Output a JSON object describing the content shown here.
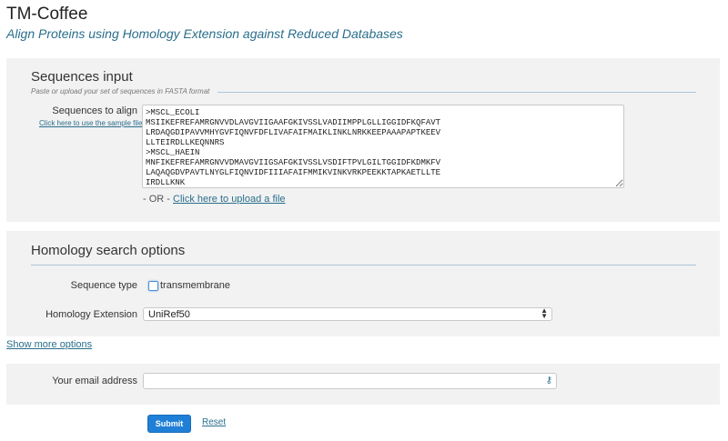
{
  "header": {
    "title": "TM-Coffee",
    "subtitle": "Align Proteins using Homology Extension against Reduced Databases"
  },
  "sequences_section": {
    "legend": "Sequences input",
    "help": "Paste or upload your set of sequences in FASTA format",
    "label": "Sequences to align",
    "sample_link": "Click here to use the sample file",
    "value": ">MSCL_ECOLI\nMSIIKEFREFAMRGNVVDLAVGVIIGAAFGKIVSSLVADIIMPPLGLLIGGIDFKQFAVT\nLRDAQGDIPAVVMHYGVFIQNVFDFLIVAFAIFMAIKLINKLNRKKEEPAAAPAPTKEEV\nLLTEIRDLLKEQNNRS\n>MSCL_HAEIN\nMNFIKEFREFAMRGNVVDMAVGVIIGSAFGKIVSSLVSDIFTPVLGILTGGIDFKDMKFV\nLAQAQGDVPAVTLNYGLFIQNVIDFIIIAFAIFMMIKVINKVRKPEEKKTAPKAETLLTE\nIRDLLKNK",
    "upload_prefix": "- OR - ",
    "upload_link": "Click here to upload a file"
  },
  "homology_section": {
    "legend": "Homology search options",
    "sequence_type_label": "Sequence type",
    "checkbox_label": "transmembrane",
    "checkbox_checked": false,
    "extension_label": "Homology Extension",
    "extension_value": "UniRef50"
  },
  "show_more": "Show more options",
  "email_section": {
    "label": "Your email address",
    "value": ""
  },
  "actions": {
    "submit": "Submit",
    "reset": "Reset"
  },
  "colors": {
    "accent": "#2a6e8c",
    "submit_bg": "#1f7fd6",
    "panel_bg": "#f2f2f2"
  }
}
